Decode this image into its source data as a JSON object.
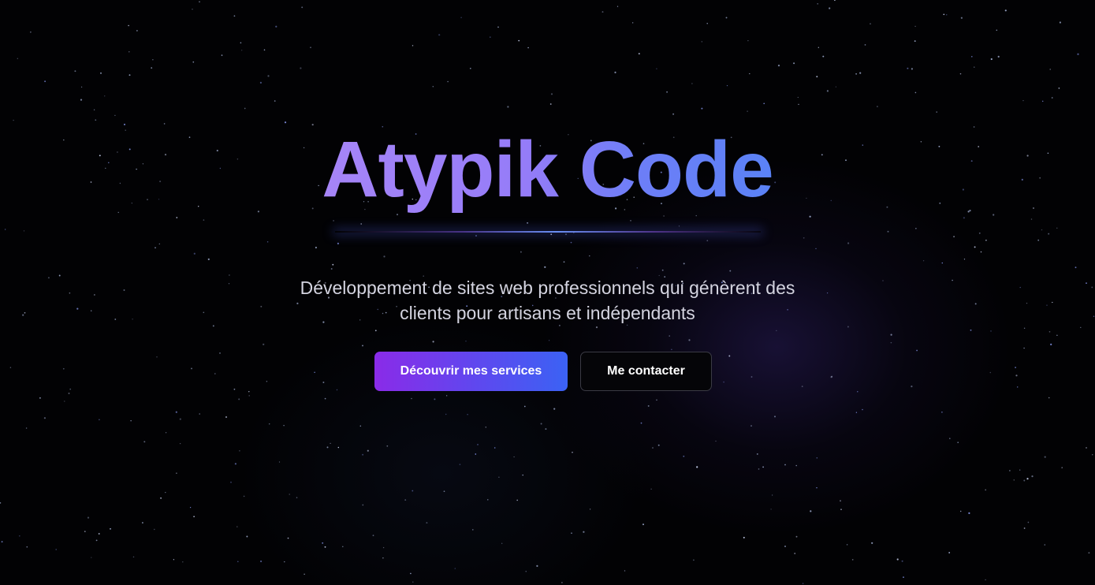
{
  "hero": {
    "title": "Atypik Code",
    "subtitle_line1": "Développement de sites web professionnels qui génèrent des",
    "subtitle_line2": "clients pour artisans et indépendants",
    "primary_button_label": "Découvrir mes services",
    "secondary_button_label": "Me contacter"
  },
  "colors": {
    "background": "#020204",
    "title_gradient_start": "#a685f7",
    "title_gradient_end": "#5a82f6",
    "primary_button_start": "#8a2be8",
    "primary_button_end": "#3b62f4",
    "subtitle_text": "#d4d4e0",
    "secondary_button_border": "#3a3a44"
  }
}
